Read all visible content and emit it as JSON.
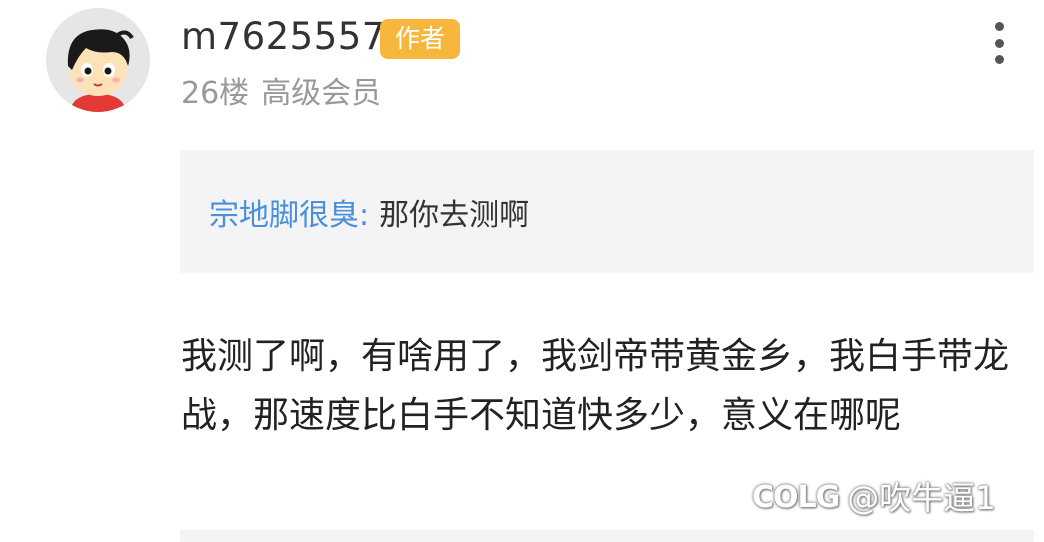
{
  "post": {
    "username": "m7625557",
    "author_badge": "作者",
    "floor": "26楼",
    "member_level": "高级会员",
    "quote": {
      "author": "宗地脚很臭:",
      "text": "那你去测啊"
    },
    "content": "我测了啊，有啥用了，我剑帝带黄金乡，我白手带龙战，那速度比白手不知道快多少，意义在哪呢"
  },
  "watermark": {
    "logo": "COLG",
    "handle": "@吹牛逼1"
  },
  "icons": {
    "avatar": "cartoon-boy-avatar",
    "more": "more-vertical-icon"
  },
  "colors": {
    "author_badge": "#f6b73c",
    "quote_author": "#4a90d9",
    "quote_background": "#f4f4f6"
  }
}
